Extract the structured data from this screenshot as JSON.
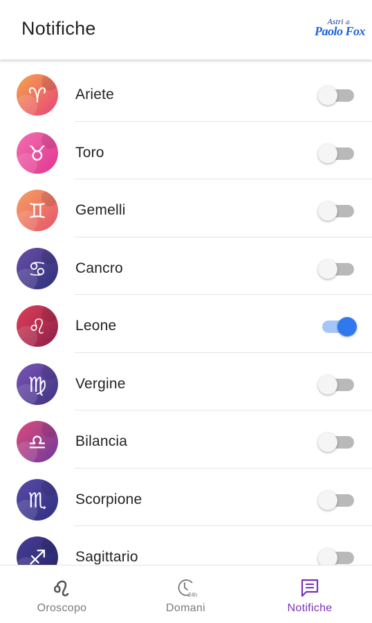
{
  "header": {
    "title": "Notifiche",
    "logo_line1": "Astri",
    "logo_line1_small": "di",
    "logo_line2": "Paolo Fox",
    "logo_color": "#1f63d6"
  },
  "signs": [
    {
      "label": "Ariete",
      "enabled": false,
      "icon": "aries-icon",
      "glyph": "♈",
      "c1": "#f3a64b",
      "c2": "#e8437a"
    },
    {
      "label": "Toro",
      "enabled": false,
      "icon": "taurus-icon",
      "glyph": "♉",
      "c1": "#f26fb0",
      "c2": "#e0358f"
    },
    {
      "label": "Gemelli",
      "enabled": false,
      "icon": "gemini-icon",
      "glyph": "♊",
      "c1": "#f7a060",
      "c2": "#e5536c"
    },
    {
      "label": "Cancro",
      "enabled": false,
      "icon": "cancer-icon",
      "glyph": "♋",
      "c1": "#6a4fa8",
      "c2": "#2c2f78"
    },
    {
      "label": "Leone",
      "enabled": true,
      "icon": "leo-icon",
      "glyph": "♌",
      "c1": "#e0405a",
      "c2": "#8a1f48"
    },
    {
      "label": "Vergine",
      "enabled": false,
      "icon": "virgo-icon",
      "glyph": "♍",
      "c1": "#7b55b8",
      "c2": "#3d3380"
    },
    {
      "label": "Bilancia",
      "enabled": false,
      "icon": "libra-icon",
      "glyph": "♎",
      "c1": "#e04a7a",
      "c2": "#6b3a9c"
    },
    {
      "label": "Scorpione",
      "enabled": false,
      "icon": "scorpio-icon",
      "glyph": "♏",
      "c1": "#5a4ba8",
      "c2": "#2e2f7e"
    },
    {
      "label": "Sagittario",
      "enabled": false,
      "icon": "sagittarius-icon",
      "glyph": "♐",
      "c1": "#4a3e98",
      "c2": "#232566"
    }
  ],
  "toggle_colors": {
    "on_track": "#a6c6f7",
    "on_thumb": "#2f78ee",
    "off_track": "#b9b9b9",
    "off_thumb": "#f5f5f5"
  },
  "nav": [
    {
      "label": "Oroscopo",
      "icon": "leo-icon",
      "active": false
    },
    {
      "label": "Domani",
      "icon": "clock-24h-icon",
      "active": false
    },
    {
      "label": "Notifiche",
      "icon": "chat-icon",
      "active": true
    }
  ],
  "accent": "#7b2fb8"
}
